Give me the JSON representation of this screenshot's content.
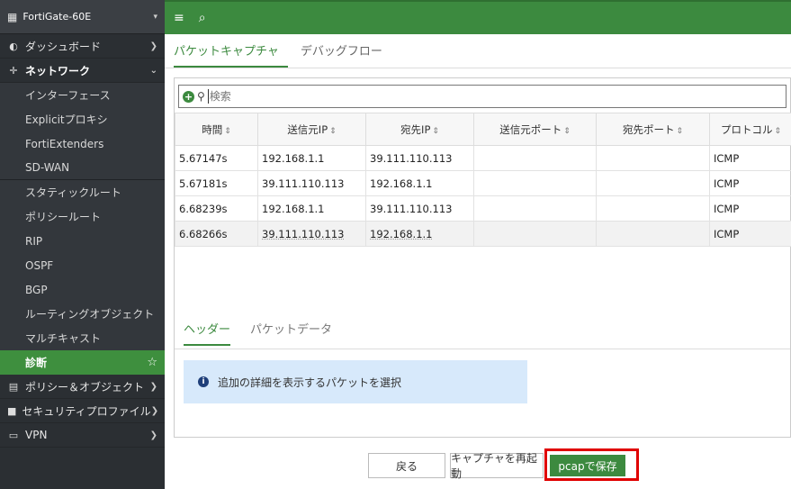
{
  "sidebar": {
    "device_name": "FortiGate-60E",
    "items": [
      {
        "icon": "dashboard-icon",
        "glyph": "◐",
        "label": "ダッシュボード"
      },
      {
        "icon": "network-icon",
        "glyph": "✛",
        "label": "ネットワーク"
      }
    ],
    "network_sub": [
      "インターフェース",
      "Explicitプロキシ",
      "FortiExtenders",
      "SD-WAN",
      "スタティックルート",
      "ポリシールート",
      "RIP",
      "OSPF",
      "BGP",
      "ルーティングオブジェクト",
      "マルチキャスト",
      "診断"
    ],
    "bottom_items": [
      {
        "icon": "policy-icon",
        "glyph": "▤",
        "label": "ポリシー＆オブジェクト"
      },
      {
        "icon": "lock-icon",
        "glyph": "■",
        "label": "セキュリティプロファイル"
      },
      {
        "icon": "vpn-icon",
        "glyph": "▭",
        "label": "VPN"
      }
    ]
  },
  "topbar": {
    "menu_glyph": "≡",
    "search_glyph": "⌕"
  },
  "tabs": [
    "パケットキャプチャ",
    "デバッグフロー"
  ],
  "search": {
    "placeholder": "検索"
  },
  "table": {
    "columns": [
      "時間",
      "送信元IP",
      "宛先IP",
      "送信元ポート",
      "宛先ポート",
      "プロトコル"
    ],
    "rows": [
      [
        "5.67147s",
        "192.168.1.1",
        "39.111.110.113",
        "",
        "",
        "ICMP"
      ],
      [
        "5.67181s",
        "39.111.110.113",
        "192.168.1.1",
        "",
        "",
        "ICMP"
      ],
      [
        "6.68239s",
        "192.168.1.1",
        "39.111.110.113",
        "",
        "",
        "ICMP"
      ],
      [
        "6.68266s",
        "39.111.110.113",
        "192.168.1.1",
        "",
        "",
        "ICMP"
      ]
    ]
  },
  "subtabs": [
    "ヘッダー",
    "パケットデータ"
  ],
  "info_text": "追加の詳細を表示するパケットを選択",
  "buttons": {
    "back": "戻る",
    "restart": "キャプチャを再起動",
    "save": "pcapで保存"
  },
  "colors": {
    "accent": "#3c8a3f",
    "highlight": "#e00000",
    "sidebar": "#2b2f33"
  }
}
